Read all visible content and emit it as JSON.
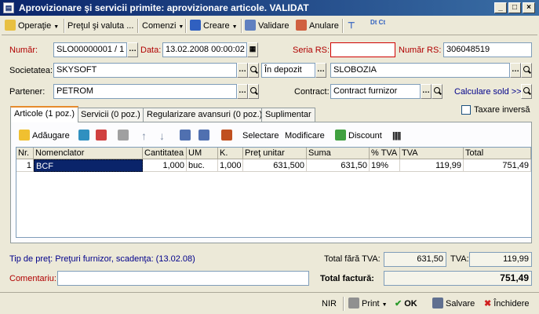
{
  "window": {
    "title": "Aprovizionare şi servicii primite: aprovizionare articole. VALIDAT"
  },
  "toolbar": {
    "operatie": "Operaţie",
    "pretul": "Preţul şi valuta ...",
    "comenzi": "Comenzi",
    "creare": "Creare",
    "validare": "Validare",
    "anulare": "Anulare",
    "dtct": "Dt Ct"
  },
  "header": {
    "numar_label": "Număr:",
    "numar_value": "SLO00000001 / 1",
    "data_label": "Data:",
    "data_value": "13.02.2008 00:00:02",
    "seria_label": "Seria RS:",
    "seria_value": "",
    "numar_rs_label": "Număr RS:",
    "numar_rs_value": "306048519",
    "societatea_label": "Societatea:",
    "societatea_value": "SKYSOFT",
    "depozit_value": "În depozit",
    "depozit_name": "SLOBOZIA",
    "partener_label": "Partener:",
    "partener_value": "PETROM",
    "contract_label": "Contract:",
    "contract_value": "Contract furnizor",
    "calc_sold": "Calculare sold >>",
    "taxare_inversa": "Taxare inversă"
  },
  "tabs": [
    {
      "label": "Articole (1 poz.)"
    },
    {
      "label": "Servicii (0 poz.)"
    },
    {
      "label": "Regularizare avansuri (0 poz.)"
    },
    {
      "label": "Suplimentar"
    }
  ],
  "grid_toolbar": {
    "adaugare": "Adăugare",
    "selectare": "Selectare",
    "modificare": "Modificare",
    "discount": "Discount"
  },
  "grid": {
    "columns": [
      "Nr.",
      "Nomenclator",
      "Cantitatea",
      "UM",
      "K.",
      "Preţ unitar",
      "Suma",
      "% TVA",
      "TVA",
      "Total"
    ],
    "rows": [
      [
        "1",
        "BCF",
        "1,000",
        "buc.",
        "1,000",
        "631,500",
        "631,50",
        "19%",
        "119,99",
        "751,49"
      ]
    ]
  },
  "footer": {
    "tip_pret": "Tip de preţ: Preţuri furnizor, scadenţa:  (13.02.08)",
    "total_fara_tva_label": "Total fără TVA:",
    "total_fara_tva_value": "631,50",
    "tva_label": "TVA:",
    "tva_value": "119,99",
    "comentariu_label": "Comentariu:",
    "comentariu_value": "",
    "total_factura_label": "Total factură:",
    "total_factura_value": "751,49"
  },
  "statusbar": {
    "nir": "NIR",
    "print": "Print",
    "ok": "OK",
    "salvare": "Salvare",
    "inchidere": "Închidere"
  }
}
